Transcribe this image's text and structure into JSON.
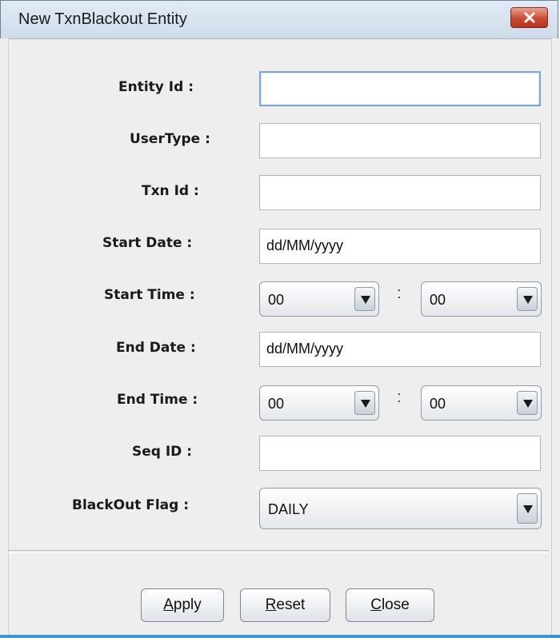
{
  "window": {
    "title": "New  TxnBlackout Entity"
  },
  "form": {
    "entity_id": {
      "label": "Entity Id :",
      "value": ""
    },
    "user_type": {
      "label": "UserType :",
      "value": ""
    },
    "txn_id": {
      "label": "Txn Id :",
      "value": ""
    },
    "start_date": {
      "label": "Start Date :",
      "value": "dd/MM/yyyy"
    },
    "start_time": {
      "label": "Start Time :",
      "hour": "00",
      "minute": "00",
      "separator": ":"
    },
    "end_date": {
      "label": "End Date :",
      "value": "dd/MM/yyyy"
    },
    "end_time": {
      "label": "End Time :",
      "hour": "00",
      "minute": "00",
      "separator": ":"
    },
    "seq_id": {
      "label": "Seq ID :",
      "value": ""
    },
    "blackout_flag": {
      "label": "BlackOut Flag :",
      "value": "DAILY"
    }
  },
  "buttons": {
    "apply": {
      "mnemonic": "A",
      "rest": "pply"
    },
    "reset": {
      "mnemonic": "R",
      "rest": "eset"
    },
    "close": {
      "mnemonic": "C",
      "rest": "lose"
    }
  },
  "colors": {
    "close_button": "#c94a32",
    "accent_line": "#3c97c8",
    "focus_border": "#7aa7d6"
  },
  "icons": {
    "title_close": "close-x-icon",
    "dropdown": "chevron-down-icon"
  }
}
